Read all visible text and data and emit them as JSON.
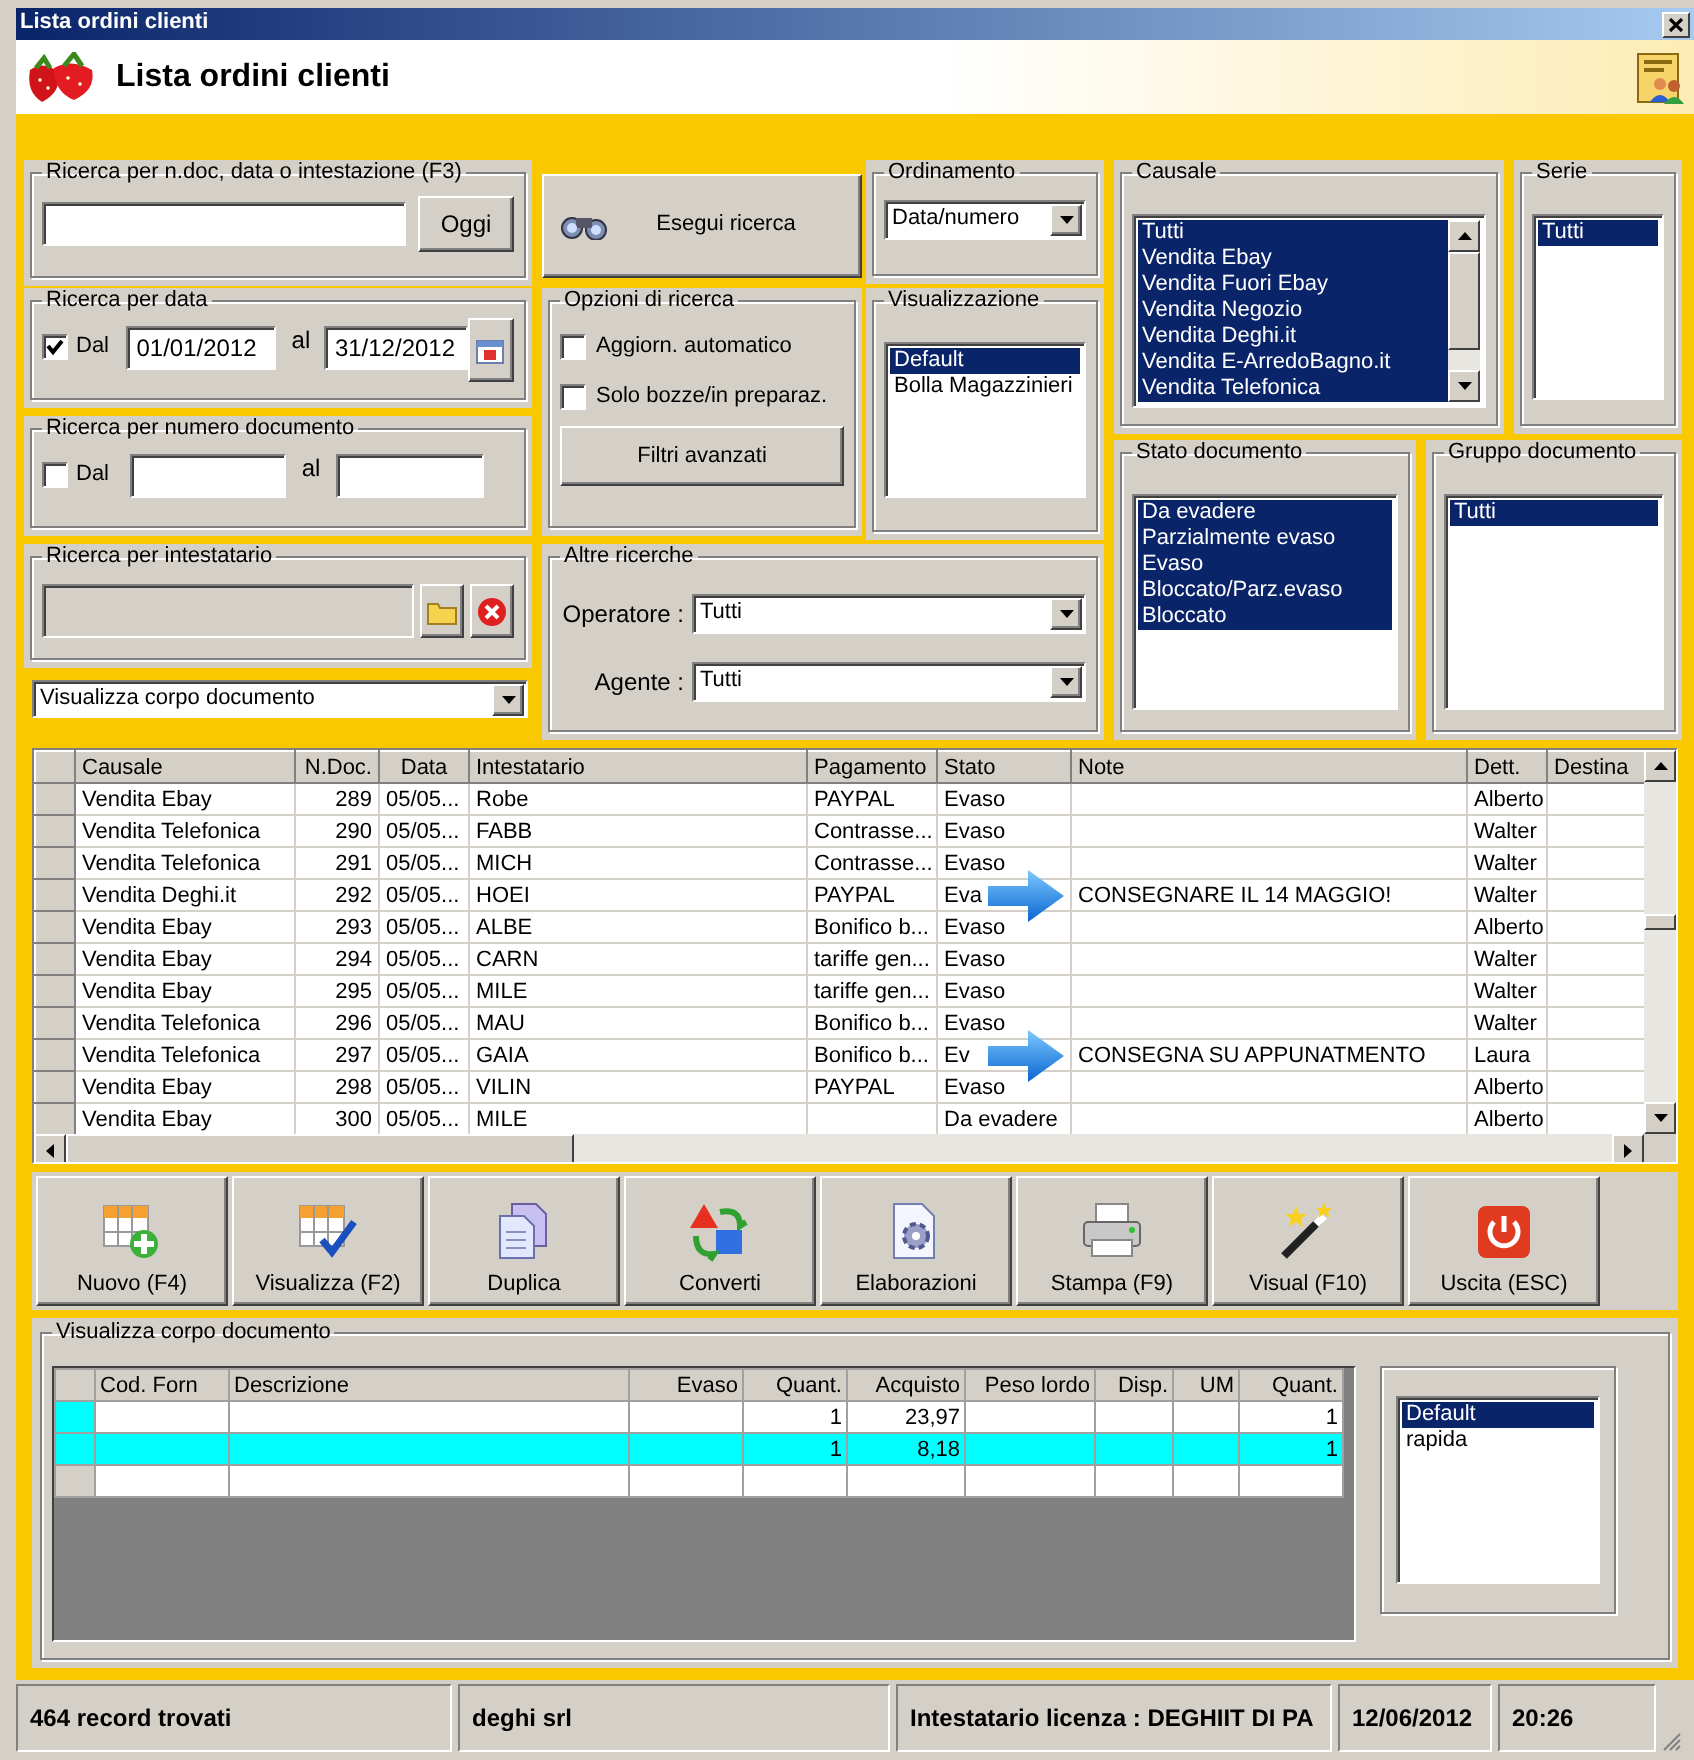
{
  "window": {
    "title": "Lista ordini clienti"
  },
  "header": {
    "title": "Lista ordini clienti"
  },
  "search_text": {
    "label": "Ricerca per n.doc, data o intestazione (F3)",
    "button": "Oggi"
  },
  "date_search": {
    "label": "Ricerca per data",
    "checkbox": "Dal",
    "checked": true,
    "from": "01/01/2012",
    "to_label": "al",
    "to": "31/12/2012"
  },
  "number_search": {
    "label": "Ricerca per numero documento",
    "checkbox": "Dal",
    "checked": false,
    "to_label": "al"
  },
  "holder_search": {
    "label": "Ricerca per intestatario"
  },
  "body_view_select": {
    "value": "Visualizza corpo documento"
  },
  "search_button": "Esegui ricerca",
  "options": {
    "label": "Opzioni di ricerca",
    "checks": [
      {
        "label": "Aggiorn. automatico",
        "checked": false
      },
      {
        "label": "Solo bozze/in preparaz.",
        "checked": false
      }
    ],
    "button": "Filtri avanzati"
  },
  "sorting": {
    "label": "Ordinamento",
    "value": "Data/numero"
  },
  "view": {
    "label": "Visualizzazione",
    "items": [
      {
        "label": "Default",
        "selected": true
      },
      {
        "label": "Bolla Magazzinieri",
        "selected": false
      }
    ]
  },
  "other_search": {
    "label": "Altre ricerche",
    "fields": [
      {
        "label": "Operatore :",
        "value": "Tutti"
      },
      {
        "label": "Agente :",
        "value": "Tutti"
      }
    ]
  },
  "causale": {
    "label": "Causale",
    "items": [
      {
        "label": "Tutti",
        "selected": true
      },
      {
        "label": "Vendita Ebay",
        "selected": true
      },
      {
        "label": "Vendita Fuori Ebay",
        "selected": true
      },
      {
        "label": "Vendita Negozio",
        "selected": true
      },
      {
        "label": "Vendita Deghi.it",
        "selected": true
      },
      {
        "label": "Vendita E-ArredoBagno.it",
        "selected": true
      },
      {
        "label": "Vendita Telefonica",
        "selected": true
      }
    ]
  },
  "serie": {
    "label": "Serie",
    "items": [
      {
        "label": "Tutti",
        "selected": true
      }
    ]
  },
  "stato": {
    "label": "Stato documento",
    "items": [
      {
        "label": "Da evadere",
        "selected": true
      },
      {
        "label": "Parzialmente evaso",
        "selected": true
      },
      {
        "label": "Evaso",
        "selected": true
      },
      {
        "label": "Bloccato/Parz.evaso",
        "selected": true
      },
      {
        "label": "Bloccato",
        "selected": true
      }
    ]
  },
  "gruppo": {
    "label": "Gruppo documento",
    "items": [
      {
        "label": "Tutti",
        "selected": true
      }
    ]
  },
  "orders": {
    "columns": [
      "Causale",
      "N.Doc.",
      "Data",
      "Intestatario",
      "Pagamento",
      "Stato",
      "Note",
      "Dett.",
      "Destina"
    ],
    "rows": [
      {
        "causale": "Vendita Ebay",
        "n_doc": "289",
        "data": "05/05...",
        "intestatario": "Robe",
        "pagamento": "PAYPAL",
        "stato": "Evaso",
        "dett": "Alberto",
        "arrow": false
      },
      {
        "causale": "Vendita Telefonica",
        "n_doc": "290",
        "data": "05/05...",
        "intestatario": "FABB",
        "pagamento": "Contrasse...",
        "stato": "Evaso",
        "dett": "Walter",
        "arrow": false
      },
      {
        "causale": "Vendita Telefonica",
        "n_doc": "291",
        "data": "05/05...",
        "intestatario": "MICH",
        "pagamento": "Contrasse...",
        "stato": "Evaso",
        "dett": "Walter",
        "arrow": false
      },
      {
        "causale": "Vendita Deghi.it",
        "n_doc": "292",
        "data": "05/05...",
        "intestatario": "HOEI",
        "pagamento": "PAYPAL",
        "stato": "Eva",
        "note": "CONSEGNARE IL 14 MAGGIO!",
        "dett": "Walter",
        "arrow": true
      },
      {
        "causale": "Vendita Ebay",
        "n_doc": "293",
        "data": "05/05...",
        "intestatario": "ALBE",
        "pagamento": "Bonifico b...",
        "stato": "Evaso",
        "dett": "Alberto",
        "arrow": false
      },
      {
        "causale": "Vendita Ebay",
        "n_doc": "294",
        "data": "05/05...",
        "intestatario": "CARN",
        "pagamento": "tariffe gen...",
        "stato": "Evaso",
        "dett": "Walter",
        "arrow": false
      },
      {
        "causale": "Vendita Ebay",
        "n_doc": "295",
        "data": "05/05...",
        "intestatario": "MILE",
        "pagamento": "tariffe gen...",
        "stato": "Evaso",
        "dett": "Walter",
        "arrow": false
      },
      {
        "causale": "Vendita Telefonica",
        "n_doc": "296",
        "data": "05/05...",
        "intestatario": "MAU",
        "pagamento": "Bonifico b...",
        "stato": "Evaso",
        "dett": "Walter",
        "arrow": false
      },
      {
        "causale": "Vendita Telefonica",
        "n_doc": "297",
        "data": "05/05...",
        "intestatario": "GAIA",
        "pagamento": "Bonifico b...",
        "stato": "Ev",
        "note": "CONSEGNA SU APPUNATMENTO",
        "dett": "Laura",
        "arrow": true
      },
      {
        "causale": "Vendita Ebay",
        "n_doc": "298",
        "data": "05/05...",
        "intestatario": "VILIN",
        "pagamento": "PAYPAL",
        "stato": "Evaso",
        "dett": "Alberto",
        "arrow": false
      },
      {
        "causale": "Vendita Ebay",
        "n_doc": "300",
        "data": "05/05...",
        "intestatario": "MILE",
        "stato": "Da evadere",
        "dett": "Alberto",
        "arrow": false
      }
    ]
  },
  "toolbar": [
    {
      "label": "Nuovo (F4)",
      "kind": "new"
    },
    {
      "label": "Visualizza (F2)",
      "kind": "view"
    },
    {
      "label": "Duplica",
      "kind": "duplicate"
    },
    {
      "label": "Converti",
      "kind": "convert"
    },
    {
      "label": "Elaborazioni",
      "kind": "process"
    },
    {
      "label": "Stampa (F9)",
      "kind": "print"
    },
    {
      "label": "Visual (F10)",
      "kind": "visual"
    },
    {
      "label": "Uscita (ESC)",
      "kind": "exit"
    }
  ],
  "body": {
    "label": "Visualizza corpo documento",
    "columns": [
      "Cod. Forn",
      "Descrizione",
      "Evaso",
      "Quant.",
      "Acquisto",
      "Peso lordo",
      "Disp.",
      "UM",
      "Quant."
    ],
    "rows": [
      {
        "quant": "1",
        "acquisto": "23,97",
        "quant_2": "1",
        "selected": false
      },
      {
        "quant": "1",
        "acquisto": "8,18",
        "quant_2": "1",
        "selected": true
      },
      {
        "selected": false
      }
    ],
    "layouts": [
      {
        "label": "Default",
        "selected": true
      },
      {
        "label": "rapida",
        "selected": false
      }
    ]
  },
  "status_bar": [
    "464 record trovati",
    "deghi srl",
    "Intestatario licenza : DEGHIIT DI PA",
    "12/06/2012",
    "20:26"
  ]
}
